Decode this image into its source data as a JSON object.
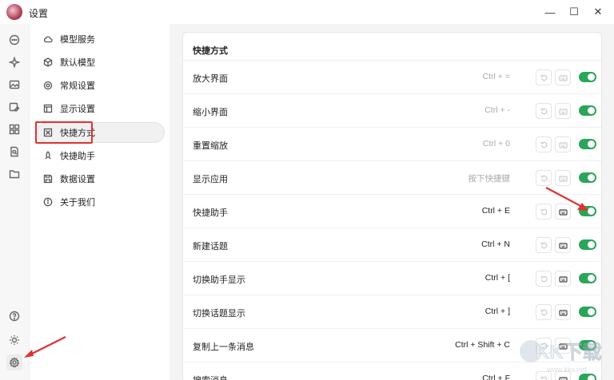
{
  "window": {
    "title": "设置",
    "controls": {
      "minimize": "—",
      "maximize": "☐",
      "close": "✕"
    }
  },
  "iconbar": {
    "items": [
      "chat-icon",
      "sparkle-icon",
      "image-icon",
      "image-edit-icon",
      "apps-icon",
      "search-doc-icon",
      "folder-icon"
    ],
    "bottom": [
      "help-icon",
      "sun-icon",
      "settings-icon"
    ]
  },
  "sidebar": {
    "items": [
      {
        "label": "模型服务",
        "icon": "cloud-icon"
      },
      {
        "label": "默认模型",
        "icon": "cube-icon"
      },
      {
        "label": "常规设置",
        "icon": "gear-icon"
      },
      {
        "label": "显示设置",
        "icon": "layout-icon"
      },
      {
        "label": "快捷方式",
        "icon": "shortcut-icon",
        "active": true
      },
      {
        "label": "快捷助手",
        "icon": "rocket-icon"
      },
      {
        "label": "数据设置",
        "icon": "save-icon"
      },
      {
        "label": "关于我们",
        "icon": "info-icon"
      }
    ]
  },
  "panel": {
    "title": "快捷方式",
    "rows": [
      {
        "name": "放大界面",
        "key": "Ctrl + =",
        "enabled": false
      },
      {
        "name": "缩小界面",
        "key": "Ctrl + -",
        "enabled": false
      },
      {
        "name": "重置缩放",
        "key": "Ctrl + 0",
        "enabled": false
      },
      {
        "name": "显示应用",
        "key": "按下快捷键",
        "enabled": false
      },
      {
        "name": "快捷助手",
        "key": "Ctrl + E",
        "enabled": true
      },
      {
        "name": "新建话题",
        "key": "Ctrl + N",
        "enabled": true
      },
      {
        "name": "切换助手显示",
        "key": "Ctrl + [",
        "enabled": true
      },
      {
        "name": "切换话题显示",
        "key": "Ctrl + ]",
        "enabled": true
      },
      {
        "name": "复制上一条消息",
        "key": "Ctrl + Shift + C",
        "enabled": true
      },
      {
        "name": "搜索消息",
        "key": "Ctrl + F",
        "enabled": true
      }
    ]
  },
  "colors": {
    "toggle_on": "#2aa55a",
    "annotation": "#e0322f"
  },
  "watermark": {
    "text": "KK下载",
    "url": "www.kkx.net"
  }
}
